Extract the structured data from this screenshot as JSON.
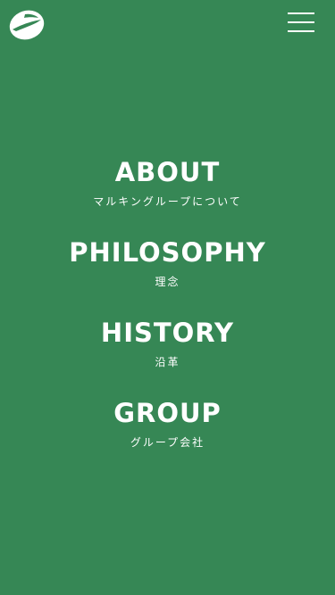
{
  "colors": {
    "background": "#368755",
    "foreground": "#ffffff"
  },
  "header": {
    "logo_icon": "brand-logo-icon",
    "menu_icon": "hamburger-menu-icon"
  },
  "nav": {
    "items": [
      {
        "title": "ABOUT",
        "subtitle": "マルキングループについて"
      },
      {
        "title": "PHILOSOPHY",
        "subtitle": "理念"
      },
      {
        "title": "HISTORY",
        "subtitle": "沿革"
      },
      {
        "title": "GROUP",
        "subtitle": "グループ会社"
      }
    ]
  }
}
